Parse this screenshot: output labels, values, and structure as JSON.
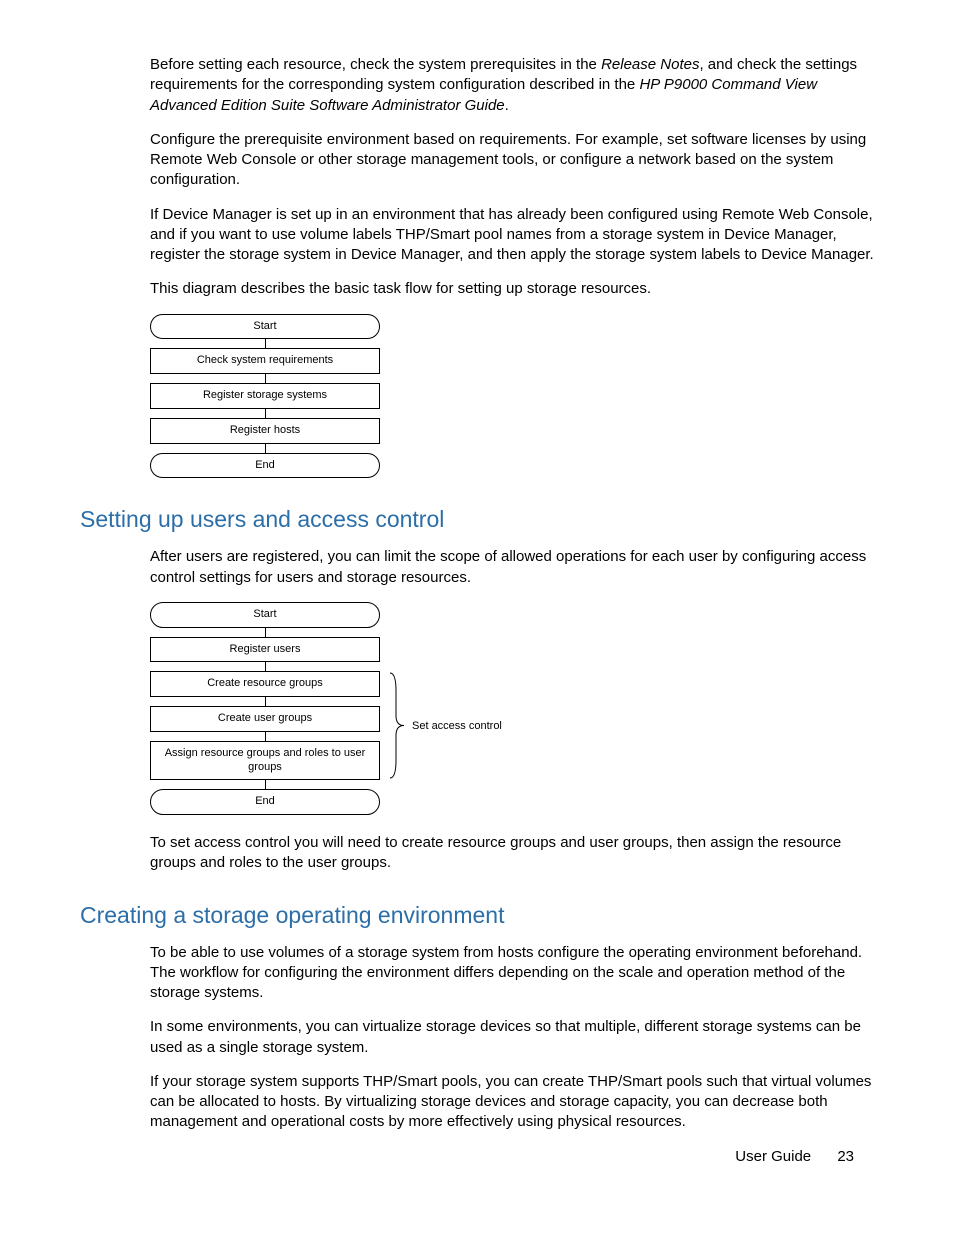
{
  "paragraphs": {
    "p1a": "Before setting each resource, check the system prerequisites in the ",
    "p1i1": "Release Notes",
    "p1b": ", and check the settings requirements for the corresponding system configuration described in the ",
    "p1i2": "HP P9000 Command View Advanced Edition Suite Software Administrator Guide",
    "p1c": ".",
    "p2": "Configure the prerequisite environment based on requirements. For example, set software licenses by using Remote Web Console or other storage management tools, or configure a network based on the system configuration.",
    "p3": "If Device Manager is set up in an environment that has already been configured using Remote Web Console, and if you want to use volume labels THP/Smart pool names from a storage system in Device Manager, register the storage system in Device Manager, and then apply the storage system labels to Device Manager.",
    "p4": "This diagram describes the basic task flow for setting up storage resources."
  },
  "flow1": {
    "n0": "Start",
    "n1": "Check system requirements",
    "n2": "Register storage systems",
    "n3": "Register hosts",
    "n4": "End"
  },
  "section1": {
    "title": "Setting up users and access control",
    "p1": "After users are registered, you can limit the scope of allowed operations for each user by configuring access control settings for users and storage resources.",
    "p2": "To set access control you will need to create resource groups and user groups, then assign the resource groups and roles to the user groups."
  },
  "flow2": {
    "n0": "Start",
    "n1": "Register users",
    "n2": "Create resource groups",
    "n3": "Create user groups",
    "n4": "Assign resource groups and roles to user groups",
    "n5": "End",
    "brace": "Set access control"
  },
  "section2": {
    "title": "Creating a storage operating environment",
    "p1": "To be able to use volumes of a storage system from hosts configure the operating environment beforehand. The workflow for configuring the environment differs depending on the scale and operation method of the storage systems.",
    "p2": "In some environments, you can virtualize storage devices so that multiple, different storage systems can be used as a single storage system.",
    "p3": "If your storage system supports THP/Smart pools, you can create THP/Smart pools such that virtual volumes can be allocated to hosts. By virtualizing storage devices and storage capacity, you can decrease both management and operational costs by more effectively using physical resources."
  },
  "footer": {
    "label": "User Guide",
    "page": "23"
  }
}
